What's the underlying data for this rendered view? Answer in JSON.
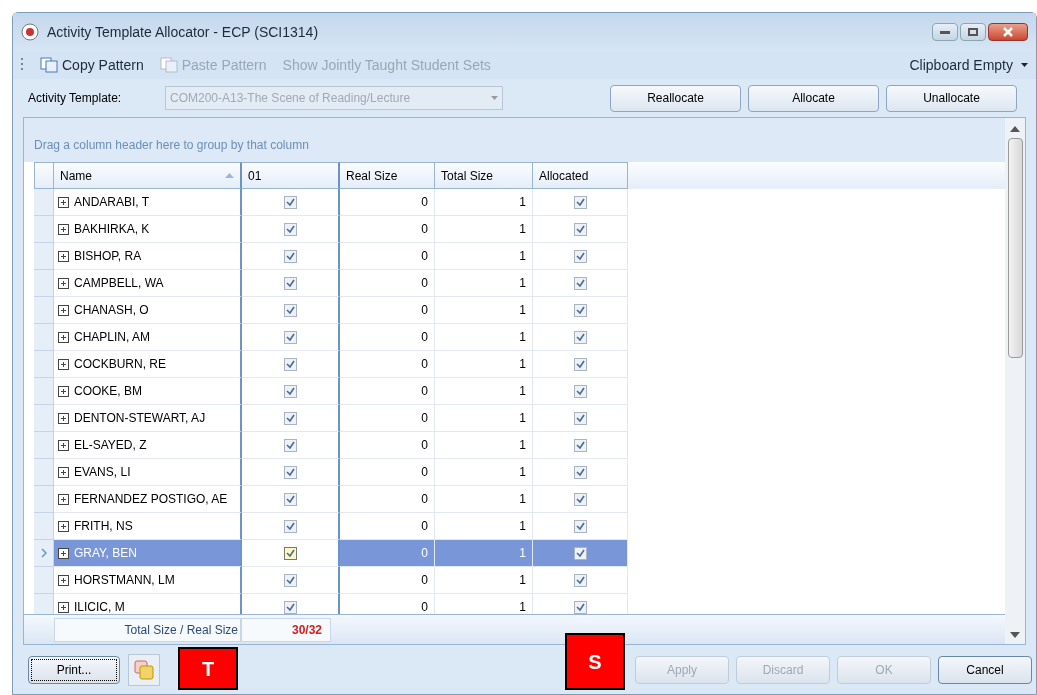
{
  "window": {
    "title": "Activity Template Allocator - ECP (SCI1314)"
  },
  "toolbar": {
    "items": [
      {
        "kind": "icon-button",
        "label": "Copy Pattern",
        "disabled": false
      },
      {
        "kind": "icon-button",
        "label": "Paste Pattern",
        "disabled": true
      },
      {
        "kind": "text-button",
        "label": "Show Jointly Taught Student Sets",
        "disabled": true
      }
    ],
    "clipboard": "Clipboard Empty"
  },
  "activity_template": {
    "label": "Activity Template:",
    "value": "COM200-A13-The Scene of Reading/Lecture",
    "disabled": true
  },
  "action_buttons": [
    "Reallocate",
    "Allocate",
    "Unallocate"
  ],
  "grid": {
    "group_hint": "Drag a column header here to group by that column",
    "columns": [
      "Name",
      "01",
      "Real Size",
      "Total Size",
      "Allocated"
    ],
    "rows": [
      {
        "name": "ANDARABI, T",
        "col_01": true,
        "real_size": "0",
        "total_size": "1",
        "allocated": true,
        "selected": false
      },
      {
        "name": "BAKHIRKA, K",
        "col_01": true,
        "real_size": "0",
        "total_size": "1",
        "allocated": true,
        "selected": false
      },
      {
        "name": "BISHOP, RA",
        "col_01": true,
        "real_size": "0",
        "total_size": "1",
        "allocated": true,
        "selected": false
      },
      {
        "name": "CAMPBELL, WA",
        "col_01": true,
        "real_size": "0",
        "total_size": "1",
        "allocated": true,
        "selected": false
      },
      {
        "name": "CHANASH, O",
        "col_01": true,
        "real_size": "0",
        "total_size": "1",
        "allocated": true,
        "selected": false
      },
      {
        "name": "CHAPLIN, AM",
        "col_01": true,
        "real_size": "0",
        "total_size": "1",
        "allocated": true,
        "selected": false
      },
      {
        "name": "COCKBURN, RE",
        "col_01": true,
        "real_size": "0",
        "total_size": "1",
        "allocated": true,
        "selected": false
      },
      {
        "name": "COOKE, BM",
        "col_01": true,
        "real_size": "0",
        "total_size": "1",
        "allocated": true,
        "selected": false
      },
      {
        "name": "DENTON-STEWART, AJ",
        "col_01": true,
        "real_size": "0",
        "total_size": "1",
        "allocated": true,
        "selected": false
      },
      {
        "name": "EL-SAYED, Z",
        "col_01": true,
        "real_size": "0",
        "total_size": "1",
        "allocated": true,
        "selected": false
      },
      {
        "name": "EVANS, LI",
        "col_01": true,
        "real_size": "0",
        "total_size": "1",
        "allocated": true,
        "selected": false
      },
      {
        "name": "FERNANDEZ POSTIGO, AE",
        "col_01": true,
        "real_size": "0",
        "total_size": "1",
        "allocated": true,
        "selected": false
      },
      {
        "name": "FRITH, NS",
        "col_01": true,
        "real_size": "0",
        "total_size": "1",
        "allocated": true,
        "selected": false
      },
      {
        "name": "GRAY, BEN",
        "col_01": true,
        "real_size": "0",
        "total_size": "1",
        "allocated": true,
        "selected": true
      },
      {
        "name": "HORSTMANN, LM",
        "col_01": true,
        "real_size": "0",
        "total_size": "1",
        "allocated": true,
        "selected": false
      },
      {
        "name": "ILICIC, M",
        "col_01": true,
        "real_size": "0",
        "total_size": "1",
        "allocated": true,
        "selected": false
      }
    ],
    "footer": {
      "label": "Total Size / Real Size",
      "value": "30/32"
    }
  },
  "bottom_buttons": [
    {
      "label": "Apply",
      "disabled": true
    },
    {
      "label": "Discard",
      "disabled": true
    },
    {
      "label": "OK",
      "disabled": true
    },
    {
      "label": "Cancel",
      "disabled": false
    }
  ],
  "print_button": "Print...",
  "callouts": [
    "T",
    "S"
  ]
}
